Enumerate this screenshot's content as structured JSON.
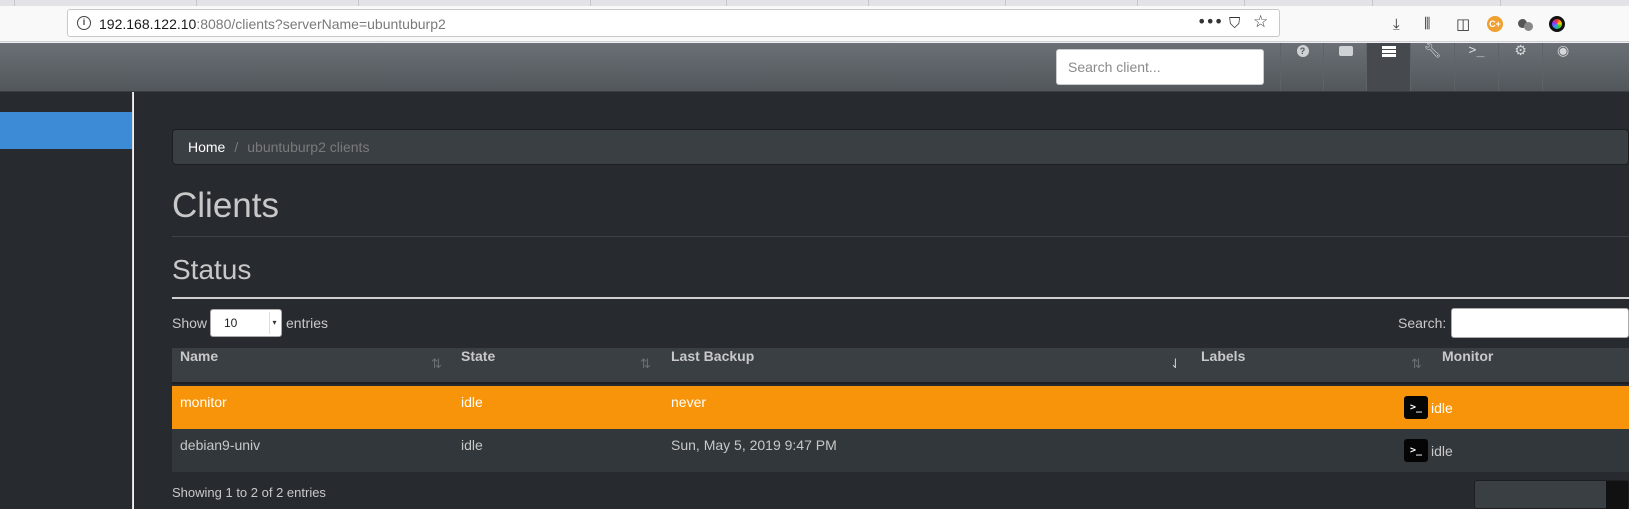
{
  "browser": {
    "url_host": "192.168.122.10",
    "url_rest": ":8080/clients?serverName=ubuntuburp2"
  },
  "navbar": {
    "search_placeholder": "Search client...",
    "buttons": [
      "help-icon",
      "server-icon",
      "clients-list-icon",
      "wrench-icon",
      "terminal-icon",
      "settings-icon",
      "user-icon"
    ]
  },
  "breadcrumb": {
    "home": "Home",
    "separator": "/",
    "current": "ubuntuburp2 clients"
  },
  "page": {
    "title": "Clients",
    "section": "Status"
  },
  "table_controls": {
    "show_label": "Show",
    "entries_value": "10",
    "entries_label": "entries",
    "search_label": "Search:"
  },
  "table": {
    "columns": [
      "Name",
      "State",
      "Last Backup",
      "Labels",
      "Monitor"
    ],
    "rows": [
      {
        "name": "monitor",
        "state": "idle",
        "last_backup": "never",
        "labels": "",
        "monitor": "idle"
      },
      {
        "name": "debian9-univ",
        "state": "idle",
        "last_backup": "Sun, May 5, 2019 9:47 PM",
        "labels": "",
        "monitor": "idle"
      }
    ]
  },
  "footer": {
    "info": "Showing 1 to 2 of 2 entries"
  },
  "colors": {
    "selected_row": "#f79409",
    "sidebar_active": "#3d8ad6",
    "background": "#272b30"
  }
}
